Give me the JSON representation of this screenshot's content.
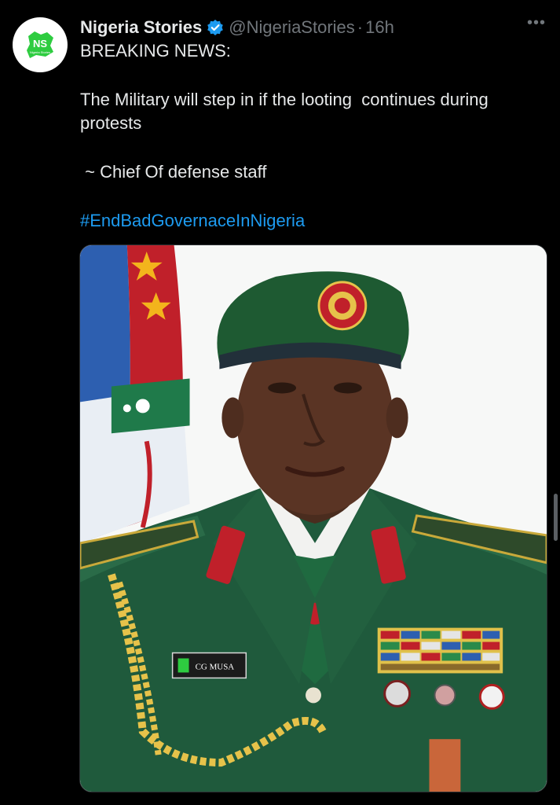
{
  "author": {
    "name": "Nigeria Stories",
    "handle": "@NigeriaStories",
    "separator": "·",
    "time": "16h",
    "avatar_initials": "NS",
    "avatar_caption": "Nigeria Stories"
  },
  "tweet": {
    "line1": "BREAKING NEWS:",
    "line2": "The Military will step in if the looting  continues during protests",
    "line3": " ~ Chief Of defense staff",
    "hashtag": "#EndBadGovernaceInNigeria"
  },
  "media": {
    "name_tag": "CG MUSA"
  },
  "icons": {
    "verified": "verified-badge-icon",
    "more": "more-options-icon"
  },
  "colors": {
    "background": "#000000",
    "text": "#e7e9ea",
    "muted": "#71767b",
    "link": "#1d9bf0",
    "verified": "#1d9bf0",
    "uniform": "#1f5a3c"
  }
}
